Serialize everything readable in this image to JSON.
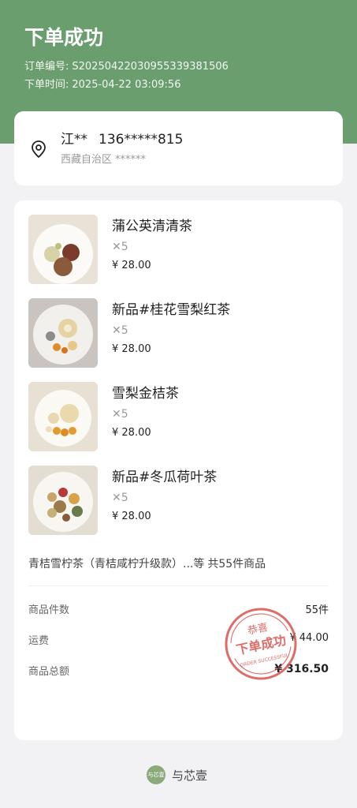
{
  "header": {
    "title": "下单成功",
    "order_no_label": "订单编号:",
    "order_no": "S2025042203095533938​1506",
    "order_time_label": "下单时间:",
    "order_time": "2025-04-22 03:09:56",
    "bg_color": "#6a9e6f"
  },
  "address": {
    "name": "江**",
    "phone": "136*****815",
    "region": "西藏自治区",
    "detail": "******",
    "icon": "location-pin-icon"
  },
  "items": [
    {
      "name": "蒲公英清清茶",
      "qty": "✕5",
      "price": "¥ 28.00"
    },
    {
      "name": "新品#桂花雪梨红茶",
      "qty": "✕5",
      "price": "¥ 28.00"
    },
    {
      "name": "雪梨金桔茶",
      "qty": "✕5",
      "price": "¥ 28.00"
    },
    {
      "name": "新品#冬瓜荷叶茶",
      "qty": "✕5",
      "price": "¥ 28.00"
    }
  ],
  "summary": {
    "more_items": "青桔雪柠茶（青桔咸柠升级款）...等",
    "total_count_text": "共55件商品"
  },
  "totals": {
    "count_label": "商品件数",
    "count_value": "55件",
    "shipping_label": "运费",
    "shipping_value": "¥ 44.00",
    "total_label": "商品总额",
    "total_value": "¥ 316.50"
  },
  "stamp": {
    "top_text": "恭喜",
    "main_text": "下单成功",
    "sub_text": "ORDER SUCCESSFUL",
    "color": "#d9534f"
  },
  "footer": {
    "logo_text": "与芯壹",
    "brand": "与芯壹"
  }
}
